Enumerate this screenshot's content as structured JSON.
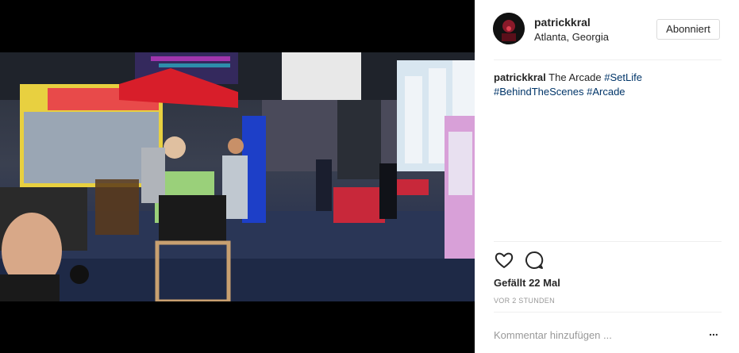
{
  "post": {
    "username": "patrickkral",
    "location": "Atlanta, Georgia",
    "follow_label": "Abonniert",
    "caption": {
      "username": "patrickkral",
      "text": "The Arcade",
      "hashtags": [
        "#SetLife",
        "#BehindTheScenes",
        "#Arcade"
      ]
    },
    "likes": "Gefällt 22 Mal",
    "time": "VOR 2 STUNDEN",
    "comment_placeholder": "Kommentar hinzufügen ...",
    "more_label": "..."
  },
  "icons": {
    "like": "heart-outline-icon",
    "comment": "speech-bubble-icon",
    "more": "more-options-icon"
  },
  "colors": {
    "hashtag": "#003569",
    "divider": "#efefef",
    "muted": "#999999",
    "text": "#262626"
  }
}
